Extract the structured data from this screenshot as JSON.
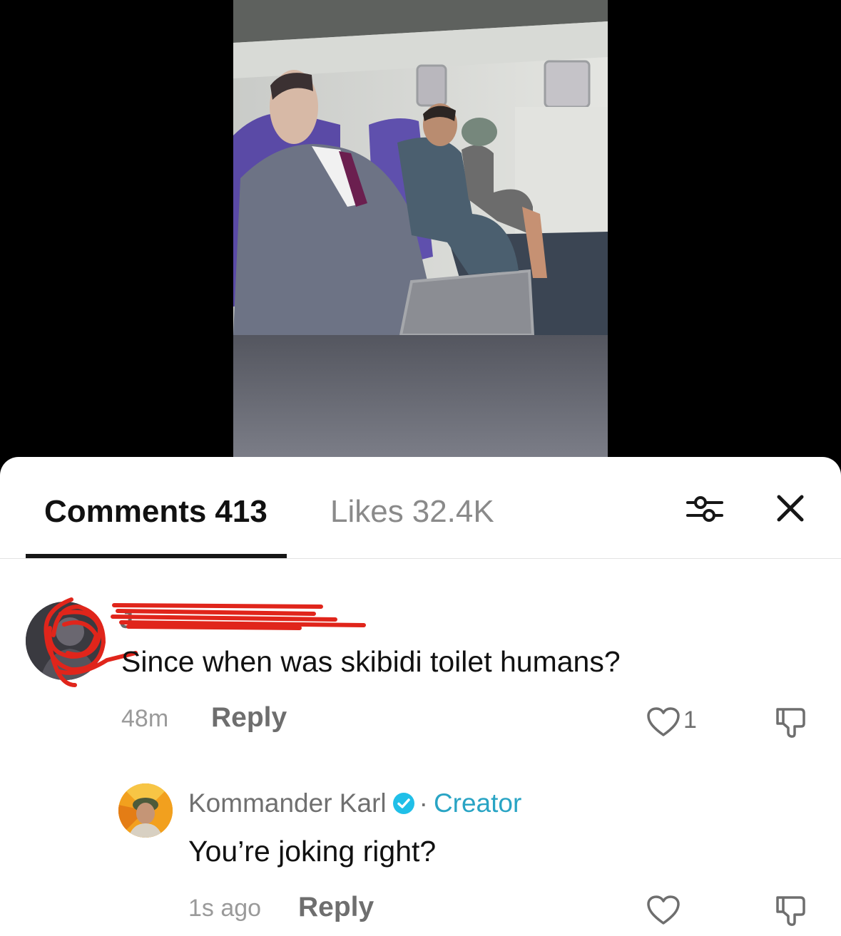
{
  "video": {
    "description_icon": "video-thumbnail"
  },
  "tabs": {
    "comments_label": "Comments",
    "comments_count": "413",
    "likes_label": "Likes",
    "likes_count": "32.4K"
  },
  "header_icons": {
    "filter": "sliders-icon",
    "close": "close-icon"
  },
  "comments": [
    {
      "username": "J",
      "username_redacted": true,
      "text": "Since when was skibidi toilet humans?",
      "time": "48m",
      "reply_label": "Reply",
      "like_count": "1"
    },
    {
      "username": "Kommander Karl",
      "verified": true,
      "separator": "·",
      "badge": "Creator",
      "text": "You’re joking right?",
      "time": "1s ago",
      "reply_label": "Reply",
      "like_count": ""
    }
  ],
  "colors": {
    "creator_accent": "#29a4c4",
    "redaction": "#e0251b",
    "tab_underline": "#161616"
  }
}
